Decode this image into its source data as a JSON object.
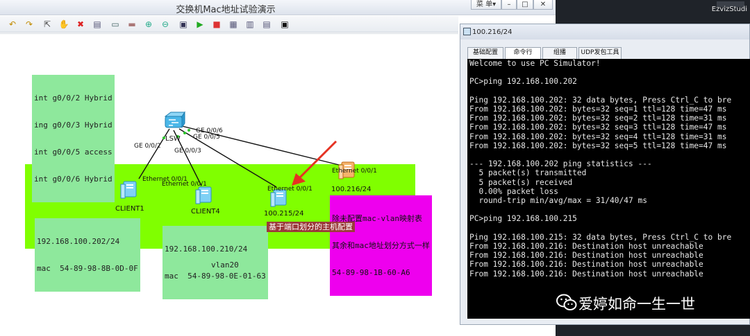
{
  "window": {
    "title": "交换机Mac地址试验演示",
    "menu_label": "菜 单▾",
    "minimize": "–",
    "maximize": "□",
    "close": "✕"
  },
  "taskbar": {
    "app_name": "EzvizStudi"
  },
  "topology": {
    "switch_label": "LSW",
    "switch_ports": [
      "GE 0/0/2",
      "GE 0/0/3",
      "GE 0/0/5",
      "GE 0/0/6"
    ],
    "port_config_lines": [
      "int g0/0/2 Hybrid",
      "ing g0/0/3 Hybrid",
      "int g0/0/5 access",
      "int g0/0/6 Hybrid"
    ],
    "hosts": [
      {
        "name": "CLIENT1",
        "port": "Ethernet 0/0/1"
      },
      {
        "name": "CLIENT4",
        "port": "Ethernet 0/0/1"
      },
      {
        "name": "100.215/24",
        "port": "Ethernet 0/0/1"
      },
      {
        "name": "100.216/24",
        "port": "Ethernet 0/0/1"
      }
    ],
    "client1_info": [
      "192.168.100.202/24",
      "mac  54-89-98-8B-0D-0F"
    ],
    "client4_info": [
      "192.168.100.210/24",
      "mac  54-89-98-0E-01-63"
    ],
    "note_unmapped": [
      "除未配置mac-vlan映射表",
      "其余和mac地址划分方式一样",
      "54-89-98-1B-60-A6"
    ],
    "note_port_based": "基于端口划分的主机配置",
    "vlan_label": "vlan20",
    "colors": {
      "vlan_area": "#80ff00",
      "note_green": "#8ee89c",
      "note_pink": "#ee00ee",
      "arrow": "#e53222"
    }
  },
  "pc_window": {
    "title": "100.216/24",
    "tabs": [
      "基础配置",
      "命令行",
      "组播",
      "UDP发包工具"
    ],
    "active_tab": "命令行",
    "console_lines": [
      "Welcome to use PC Simulator!",
      "",
      "PC>ping 192.168.100.202",
      "",
      "Ping 192.168.100.202: 32 data bytes, Press Ctrl_C to bre",
      "From 192.168.100.202: bytes=32 seq=1 ttl=128 time=47 ms",
      "From 192.168.100.202: bytes=32 seq=2 ttl=128 time=31 ms",
      "From 192.168.100.202: bytes=32 seq=3 ttl=128 time=47 ms",
      "From 192.168.100.202: bytes=32 seq=4 ttl=128 time=31 ms",
      "From 192.168.100.202: bytes=32 seq=5 ttl=128 time=47 ms",
      "",
      "--- 192.168.100.202 ping statistics ---",
      "  5 packet(s) transmitted",
      "  5 packet(s) received",
      "  0.00% packet loss",
      "  round-trip min/avg/max = 31/40/47 ms",
      "",
      "PC>ping 192.168.100.215",
      "",
      "Ping 192.168.100.215: 32 data bytes, Press Ctrl_C to bre",
      "From 192.168.100.216: Destination host unreachable",
      "From 192.168.100.216: Destination host unreachable",
      "From 192.168.100.216: Destination host unreachable",
      "From 192.168.100.216: Destination host unreachable"
    ]
  },
  "watermark": "爱婷如命一生一世"
}
